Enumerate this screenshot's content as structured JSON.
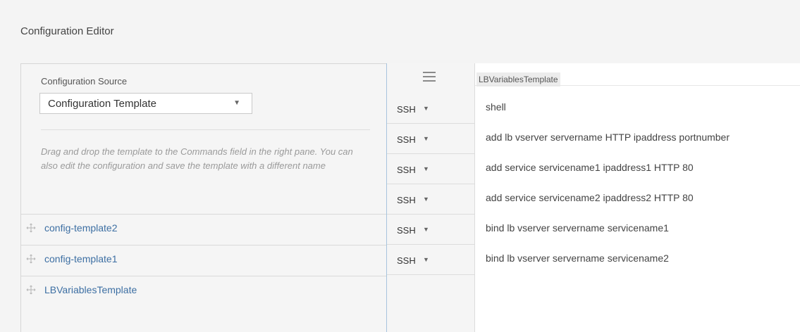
{
  "page": {
    "title": "Configuration Editor"
  },
  "left": {
    "source_label": "Configuration Source",
    "source_value": "Configuration Template",
    "hint": "Drag and drop the template to the Commands field in the right pane. You can also edit the configuration and save the template with a different name",
    "templates": [
      {
        "name": "config-template2"
      },
      {
        "name": "config-template1"
      },
      {
        "name": "LBVariablesTemplate"
      }
    ]
  },
  "commands": {
    "template_tag": "LBVariablesTemplate",
    "rows": [
      {
        "protocol": "SSH",
        "command": "shell"
      },
      {
        "protocol": "SSH",
        "command": "add lb vserver servername HTTP ipaddress portnumber"
      },
      {
        "protocol": "SSH",
        "command": "add service servicename1 ipaddress1 HTTP 80"
      },
      {
        "protocol": "SSH",
        "command": "add service servicename2 ipaddress2 HTTP 80"
      },
      {
        "protocol": "SSH",
        "command": "bind lb vserver servername servicename1"
      },
      {
        "protocol": "SSH",
        "command": "bind lb vserver servername servicename2"
      }
    ]
  },
  "icons": {
    "drag": "move-handle-icon",
    "menu": "hamburger-menu-icon",
    "dropdown": "caret-down-icon"
  },
  "colors": {
    "link": "#3d6fa3",
    "panel_divider": "#a7c4dd"
  }
}
